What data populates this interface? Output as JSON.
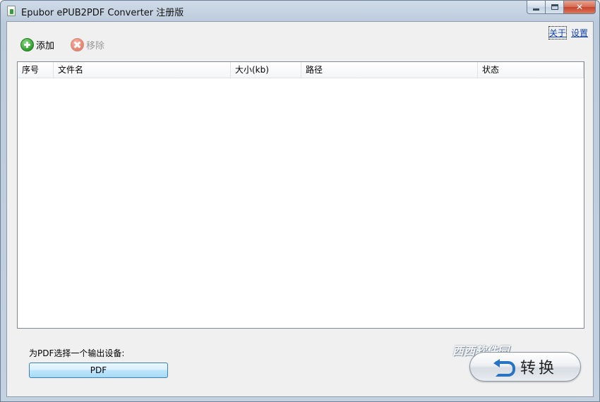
{
  "window": {
    "title": "Epubor ePUB2PDF Converter 注册版",
    "controls": {
      "minimize": "minimize",
      "maximize": "maximize",
      "close": "✕"
    }
  },
  "header_links": {
    "about": "关于",
    "settings": "设置"
  },
  "toolbar": {
    "add_label": "添加",
    "remove_label": "移除"
  },
  "file_list": {
    "columns": [
      "序号",
      "文件名",
      "大小(kb)",
      "路径",
      "状态"
    ],
    "rows": []
  },
  "output": {
    "device_label": "为PDF选择一个输出设备:",
    "device_value": "PDF"
  },
  "convert": {
    "label": "转换"
  },
  "watermark": {
    "text": "西西软件园"
  },
  "colors": {
    "link": "#0b3fb8",
    "add_icon": "#2f9b2b",
    "remove_icon": "#e27f6e",
    "convert_icon": "#2a73c3"
  }
}
